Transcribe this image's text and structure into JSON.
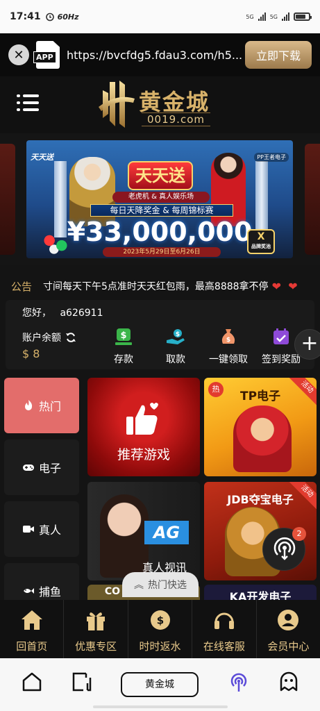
{
  "status_bar": {
    "time": "17:41",
    "refresh_rate": "60Hz",
    "network_1": "5G",
    "network_2": "5G"
  },
  "app_banner": {
    "icon_label": "APP",
    "url": "https://bvcfdg5.fdau3.com/h5...",
    "download_label": "立即下载"
  },
  "header": {
    "logo_name": "黄金城",
    "logo_domain": "0019.com"
  },
  "promo": {
    "brand_left": "天天送",
    "brand_right": "PP王者电子",
    "title": "天天送",
    "subtitle": "老虎机 & 真人娱乐场",
    "strip": "每日天降奖金 & 每周锦标赛",
    "amount": "¥33,000,000",
    "date_range": "2023年5月29日至6月26日",
    "x_badge": "X",
    "x_badge_sub": "品牌奖池"
  },
  "notice": {
    "tag": "公告",
    "text": "寸间每天下午5点准时天天红包雨，最高8888拿不停"
  },
  "account": {
    "greeting": "您好，",
    "username": "a626911",
    "balance_label": "账户余额",
    "balance": "$ 8",
    "actions": [
      "存款",
      "取款",
      "一键领取",
      "签到奖励"
    ]
  },
  "categories": [
    "热门",
    "电子",
    "真人",
    "捕鱼"
  ],
  "games": {
    "recommend": "推荐游戏",
    "tp": "TP电子",
    "ag_logo": "AG",
    "ag": "真人视讯",
    "jdb": "JDB夺宝电子",
    "ka": "KA开发电子",
    "co_partial": "CO",
    "ribbon": "活动",
    "hot": "热"
  },
  "hot_quick": "热门快选",
  "broadcast_badge": "2",
  "bottom_nav": [
    "回首页",
    "优惠专区",
    "时时返水",
    "在线客服",
    "会员中心"
  ],
  "browser": {
    "title": "黄金城"
  },
  "colors": {
    "gold": "#d8b26a",
    "accent_red": "#e36d6b",
    "bg": "#141414"
  }
}
